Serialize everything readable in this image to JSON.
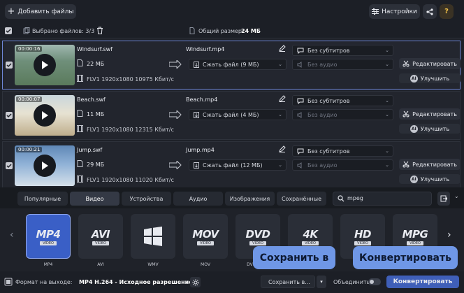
{
  "toolbar": {
    "add_files": "Добавить файлы",
    "settings": "Настройки"
  },
  "selection": {
    "selected": "Выбрано файлов: 3/3",
    "total_label": "Общий размер:",
    "total_value": "24 МБ"
  },
  "files": [
    {
      "duration": "00:00:16",
      "name": "Windsurf.swf",
      "size": "22 МБ",
      "meta": "FLV1 1920x1080 10975 Кбит/с",
      "out_name": "Windsurf.mp4",
      "compress": "Сжать файл (9 МБ)",
      "subs": "Без субтитров",
      "audio": "Без аудио",
      "edit": "Редактировать",
      "enhance": "Улучшить"
    },
    {
      "duration": "00:00:07",
      "name": "Beach.swf",
      "size": "11 МБ",
      "meta": "FLV1 1920x1080 12315 Кбит/с",
      "out_name": "Beach.mp4",
      "compress": "Сжать файл (4 МБ)",
      "subs": "Без субтитров",
      "audio": "Без аудио",
      "edit": "Редактировать",
      "enhance": "Улучшить"
    },
    {
      "duration": "00:00:21",
      "name": "Jump.swf",
      "size": "29 МБ",
      "meta": "FLV1 1920x1080 11020 Кбит/с",
      "out_name": "Jump.mp4",
      "compress": "Сжать файл (12 МБ)",
      "subs": "Без субтитров",
      "audio": "Без аудио",
      "edit": "Редактировать",
      "enhance": "Улучшить"
    }
  ],
  "tabs": [
    "Популярные",
    "Видео",
    "Устройства",
    "Аудио",
    "Изображения",
    "Сохранённые"
  ],
  "search": {
    "value": "mpeg"
  },
  "formats": [
    {
      "big": "MP4",
      "sub": "VIDEO",
      "label": "MP4"
    },
    {
      "big": "AVI",
      "sub": "VIDEO",
      "label": "AVI"
    },
    {
      "big": "",
      "sub": "",
      "label": "WMV"
    },
    {
      "big": "MOV",
      "sub": "VIDEO",
      "label": "MOV"
    },
    {
      "big": "DVD",
      "sub": "VIDEO",
      "label": "DVD-сов..."
    },
    {
      "big": "4K",
      "sub": "VIDEO",
      "label": ""
    },
    {
      "big": "HD",
      "sub": "VIDEO",
      "label": ""
    },
    {
      "big": "MPG",
      "sub": "VIDEO",
      "label": ""
    }
  ],
  "bottom": {
    "format_label": "Формат на выходе:",
    "format_value": "MP4 H.264 - Исходное разрешение",
    "save_to": "Сохранить в...",
    "merge": "Объединить:",
    "convert": "Конвертировать"
  },
  "tooltips": {
    "save": "Сохранить в",
    "convert": "Конвертировать"
  },
  "colors": {
    "accent": "#6f97e6",
    "selected_border": "#6e86d6",
    "format_active": "#3a5fc6"
  }
}
